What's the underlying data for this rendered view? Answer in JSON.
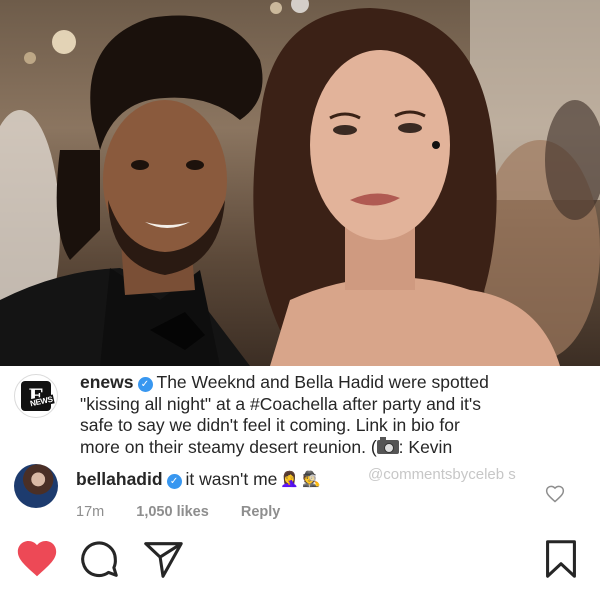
{
  "post": {
    "photo_alt": "photo",
    "caption": {
      "username": "enews",
      "line1": "The Weeknd and Bella Hadid were spotted",
      "line2": "\"kissing all night\" at a #Coachella after party and it's",
      "line3": "safe to say we didn't feel it coming. Link in bio for",
      "line4_before": "more on their steamy desert reunion. (",
      "line4_after": ": Kevin"
    },
    "comment": {
      "username": "bellahadid",
      "text": "it wasn't me",
      "emoji_1": "🤦‍♀️",
      "emoji_2": "🕵️",
      "time": "17m",
      "likes": "1,050 likes",
      "reply_label": "Reply"
    },
    "watermark": "@commentsbyceleb s"
  },
  "icons": {
    "like": "heart-icon",
    "comment": "comment-icon",
    "share": "share-icon",
    "save": "bookmark-icon",
    "verified": "verified-badge-icon",
    "camera": "camera-icon"
  },
  "colors": {
    "like_red": "#ed4956",
    "verified_blue": "#3897f0",
    "meta_gray": "#8e8e8e",
    "watermark_gray": "#c7c7c7"
  }
}
